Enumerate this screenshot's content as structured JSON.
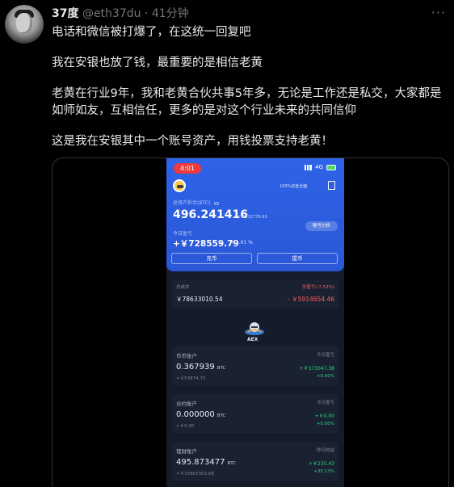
{
  "tweet": {
    "name": "37度",
    "handle": "@eth37du",
    "separator": "·",
    "time": "41分钟",
    "more": "···",
    "paragraphs": [
      "电话和微信被打爆了，在这统一回复吧",
      "我在安银也放了钱，最重要的是相信老黄",
      "老黄在行业9年，我和老黄合伙共事5年多，无论是工作还是私交，大家都是如师如友，互相信任，更多的是对这个行业未来的共同信仰",
      "这是我在安银其中一个账号资产，用钱投票支持老黄！"
    ]
  },
  "phone": {
    "status": {
      "time": "4:01",
      "network": "4G"
    },
    "header": {
      "shield_tag": "100%资金全面",
      "total_label": "总资产折合(BTC)"
    },
    "balance": {
      "btc": "496.241416",
      "fiat": "≈￥76231778.63"
    },
    "analysis_label": "账号分析",
    "today_pnl": {
      "label": "今日盈亏",
      "value": "+￥728559.79",
      "pct": "+ 1.01 %"
    },
    "buttons": {
      "deposit": "充币",
      "withdraw": "提币"
    },
    "cost": {
      "label": "总成本",
      "value": "￥78633010.54",
      "pnl_label": "总盈亏(-7.52%)",
      "pnl_value": "- ￥5914654.46"
    },
    "logo": "AEX",
    "accounts": [
      {
        "name": "币币账户",
        "right_label": "今日盈亏",
        "amount": "0.367939",
        "unit": "BTC",
        "fiat": "≈￥53874.75",
        "gain": "+￥373047.38",
        "pct": "+0.00%"
      },
      {
        "name": "合约账户",
        "right_label": "今日盈亏",
        "amount": "0.000000",
        "unit": "BTC",
        "fiat": "≈￥0.00",
        "gain": "+￥0.00",
        "pct": "+0.00%"
      },
      {
        "name": "理财账户",
        "right_label": "昨日收益",
        "amount": "495.873477",
        "unit": "BTC",
        "fiat": "≈￥72607303.68",
        "gain": "+￥235.43",
        "pct": "+35.13%"
      }
    ]
  },
  "colors": {
    "accent_blue": "#2f63e8",
    "loss_red": "#ff5a5a",
    "gain_green": "#2bd47d"
  }
}
